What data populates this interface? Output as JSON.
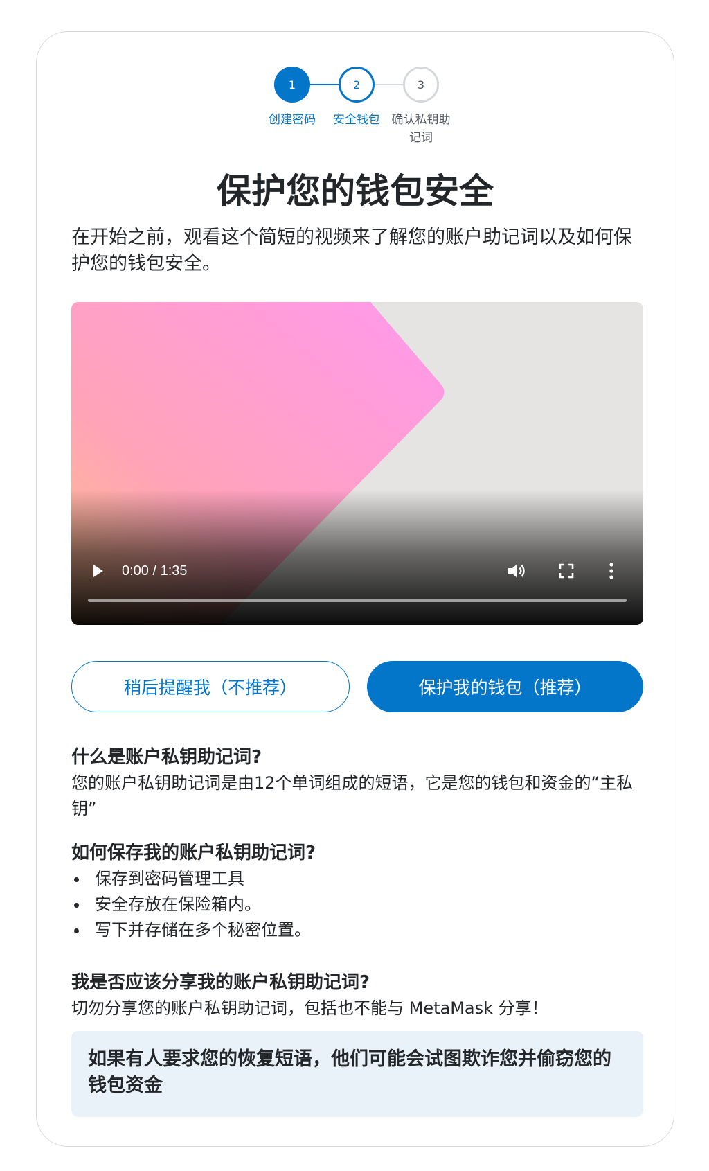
{
  "stepper": {
    "steps": [
      {
        "number": "1",
        "label": "创建密码"
      },
      {
        "number": "2",
        "label": "安全钱包"
      },
      {
        "number": "3",
        "label": "确认私钥助记词"
      }
    ]
  },
  "title": "保护您的钱包安全",
  "intro": "在开始之前，观看这个简短的视频来了解您的账户助记词以及如何保护您的钱包安全。",
  "video": {
    "time": "0:00 / 1:35",
    "progress": 0
  },
  "buttons": {
    "remind_later": "稍后提醒我（不推荐）",
    "secure_wallet": "保护我的钱包（推荐）"
  },
  "faq": {
    "q1": {
      "heading": "什么是账户私钥助记词?",
      "answer": "您的账户私钥助记词是由12个单词组成的短语，它是您的钱包和资金的“主私钥”"
    },
    "q2": {
      "heading": "如何保存我的账户私钥助记词?",
      "items": [
        "保存到密码管理工具",
        "安全存放在保险箱内。",
        "写下并存储在多个秘密位置。"
      ]
    },
    "q3": {
      "heading": "我是否应该分享我的账户私钥助记词?",
      "answer": "切勿分享您的账户私钥助记词，包括也不能与 MetaMask 分享！"
    }
  },
  "warning": "如果有人要求您的恢复短语，他们可能会试图欺诈您并偷窃您的钱包资金",
  "colors": {
    "primary": "#0376c9",
    "text": "#24272a",
    "muted": "#535a61",
    "warning_bg": "#e9f1f9"
  }
}
